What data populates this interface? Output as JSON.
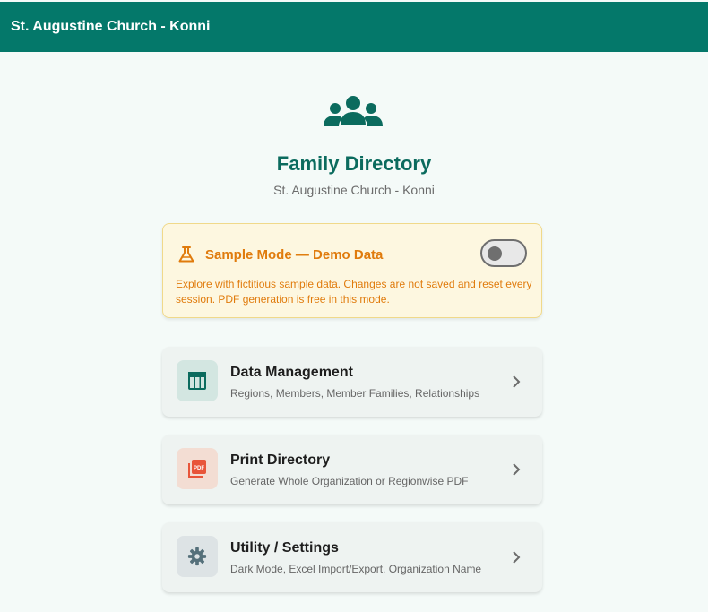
{
  "appbar": {
    "title": "St. Augustine Church - Konni"
  },
  "hero": {
    "icon": "group-icon",
    "title": "Family Directory",
    "subtitle": "St. Augustine Church - Konni"
  },
  "sample_mode": {
    "icon": "flask-icon",
    "title": "Sample Mode — Demo Data",
    "description": "Explore with fictitious sample data. Changes are not saved and reset every session. PDF generation is free in this mode.",
    "toggle_on": false
  },
  "menu": [
    {
      "icon": "table-icon",
      "title": "Data Management",
      "subtitle": "Regions, Members, Member Families, Relationships"
    },
    {
      "icon": "pdf-icon",
      "title": "Print Directory",
      "subtitle": "Generate Whole Organization or Regionwise PDF"
    },
    {
      "icon": "gear-icon",
      "title": "Utility / Settings",
      "subtitle": "Dark Mode, Excel Import/Export, Organization Name"
    }
  ],
  "colors": {
    "primary": "#04786a",
    "warning": "#e07b0c",
    "pdf_accent": "#e8553a"
  }
}
